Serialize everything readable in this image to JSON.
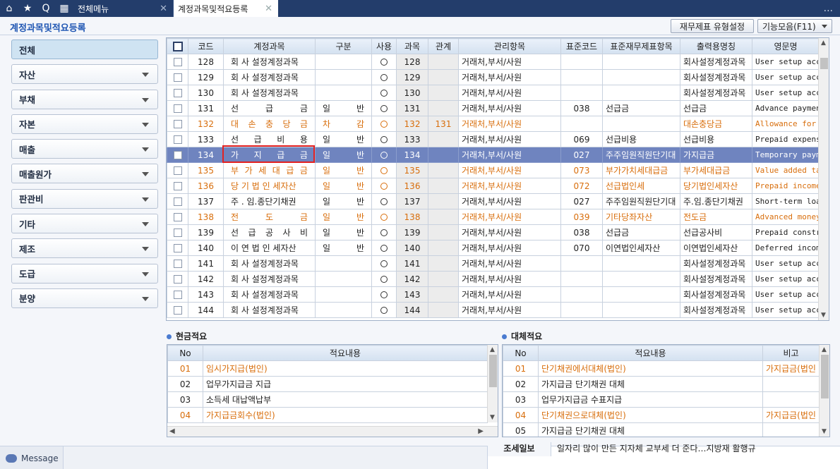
{
  "topbar": {
    "menu_tab": "전체메뉴",
    "active_tab": "계정과목및적요등록",
    "close_glyph": "✕",
    "more_glyph": "..."
  },
  "header": {
    "title": "계정과목및적요등록",
    "btn_report": "재무제표 유형설정",
    "btn_functions": "기능모음(F11)"
  },
  "sidebar": {
    "items": [
      {
        "label": "전체"
      },
      {
        "label": "자산"
      },
      {
        "label": "부채"
      },
      {
        "label": "자본"
      },
      {
        "label": "매출"
      },
      {
        "label": "매출원가"
      },
      {
        "label": "판관비"
      },
      {
        "label": "기타"
      },
      {
        "label": "제조"
      },
      {
        "label": "도급"
      },
      {
        "label": "분양"
      }
    ]
  },
  "grid": {
    "columns": [
      "코드",
      "계정과목",
      "구분",
      "사용",
      "과목",
      "관계",
      "관리항목",
      "표준코드",
      "표준재무제표항목",
      "출력용명칭",
      "영문명"
    ],
    "rows": [
      {
        "code": "128",
        "account": "회 사 설정계정과목",
        "type": "",
        "sub": "128",
        "rel": "",
        "mgmt": "거래처,부서/사원",
        "stdcode": "",
        "stditem": "",
        "print": "회사설정계정과목",
        "eng": "User setup acco"
      },
      {
        "code": "129",
        "account": "회 사 설정계정과목",
        "type": "",
        "sub": "129",
        "rel": "",
        "mgmt": "거래처,부서/사원",
        "stdcode": "",
        "stditem": "",
        "print": "회사설정계정과목",
        "eng": "User setup acco"
      },
      {
        "code": "130",
        "account": "회 사 설정계정과목",
        "type": "",
        "sub": "130",
        "rel": "",
        "mgmt": "거래처,부서/사원",
        "stdcode": "",
        "stditem": "",
        "print": "회사설정계정과목",
        "eng": "User setup acco"
      },
      {
        "code": "131",
        "account": "선 급 금",
        "type": "일 반",
        "sub": "131",
        "rel": "",
        "mgmt": "거래처,부서/사원",
        "stdcode": "038",
        "stditem": "선급금",
        "print": "선급금",
        "eng": "Advance payment"
      },
      {
        "code": "132",
        "account": "대 손 충 당 금",
        "type": "차 감",
        "sub": "132",
        "rel": "131",
        "mgmt": "거래처,부서/사원",
        "stdcode": "",
        "stditem": "",
        "print": "대손충당금",
        "eng": "Allowance for d",
        "orange": true
      },
      {
        "code": "133",
        "account": "선 급 비 용",
        "type": "일 반",
        "sub": "133",
        "rel": "",
        "mgmt": "거래처,부서/사원",
        "stdcode": "069",
        "stditem": "선급비용",
        "print": "선급비용",
        "eng": "Prepaid expense"
      },
      {
        "code": "134",
        "account": "가 지 급 금",
        "type": "일 반",
        "sub": "134",
        "rel": "",
        "mgmt": "거래처,부서/사원",
        "stdcode": "027",
        "stditem": "주주임원직원단기대",
        "print": "가지급금",
        "eng": "Temporary payme",
        "selected": true
      },
      {
        "code": "135",
        "account": "부 가 세 대 급 금",
        "type": "일 반",
        "sub": "135",
        "rel": "",
        "mgmt": "거래처,부서/사원",
        "stdcode": "073",
        "stditem": "부가가치세대급금",
        "print": "부가세대급금",
        "eng": "Value added tax",
        "orange": true
      },
      {
        "code": "136",
        "account": "당 기 법 인 세자산",
        "type": "일 반",
        "sub": "136",
        "rel": "",
        "mgmt": "거래처,부서/사원",
        "stdcode": "072",
        "stditem": "선급법인세",
        "print": "당기법인세자산",
        "eng": "Prepaid income",
        "orange": true
      },
      {
        "code": "137",
        "account": "주 . 임.종단기채권",
        "type": "일 반",
        "sub": "137",
        "rel": "",
        "mgmt": "거래처,부서/사원",
        "stdcode": "027",
        "stditem": "주주임원직원단기대",
        "print": "주.임.종단기채권",
        "eng": "Short-term loan"
      },
      {
        "code": "138",
        "account": "전 도 금",
        "type": "일 반",
        "sub": "138",
        "rel": "",
        "mgmt": "거래처,부서/사원",
        "stdcode": "039",
        "stditem": "기타당좌자산",
        "print": "전도금",
        "eng": "Advanced money",
        "orange": true
      },
      {
        "code": "139",
        "account": "선 급 공 사 비",
        "type": "일 반",
        "sub": "139",
        "rel": "",
        "mgmt": "거래처,부서/사원",
        "stdcode": "038",
        "stditem": "선급금",
        "print": "선급공사비",
        "eng": "Prepaid constru"
      },
      {
        "code": "140",
        "account": "이 연 법 인 세자산",
        "type": "일 반",
        "sub": "140",
        "rel": "",
        "mgmt": "거래처,부서/사원",
        "stdcode": "070",
        "stditem": "이연법인세자산",
        "print": "이연법인세자산",
        "eng": "Deferred income"
      },
      {
        "code": "141",
        "account": "회 사 설정계정과목",
        "type": "",
        "sub": "141",
        "rel": "",
        "mgmt": "거래처,부서/사원",
        "stdcode": "",
        "stditem": "",
        "print": "회사설정계정과목",
        "eng": "User setup acco"
      },
      {
        "code": "142",
        "account": "회 사 설정계정과목",
        "type": "",
        "sub": "142",
        "rel": "",
        "mgmt": "거래처,부서/사원",
        "stdcode": "",
        "stditem": "",
        "print": "회사설정계정과목",
        "eng": "User setup acco"
      },
      {
        "code": "143",
        "account": "회 사 설정계정과목",
        "type": "",
        "sub": "143",
        "rel": "",
        "mgmt": "거래처,부서/사원",
        "stdcode": "",
        "stditem": "",
        "print": "회사설정계정과목",
        "eng": "User setup acco"
      },
      {
        "code": "144",
        "account": "회 사 설정계정과목",
        "type": "",
        "sub": "144",
        "rel": "",
        "mgmt": "거래처,부서/사원",
        "stdcode": "",
        "stditem": "",
        "print": "회사설정계정과목",
        "eng": "User setup acco"
      }
    ]
  },
  "cash_memo": {
    "title": "현금적요",
    "columns": [
      "No",
      "적요내용"
    ],
    "rows": [
      {
        "no": "01",
        "text": "임시가지급(법인)",
        "orange": true
      },
      {
        "no": "02",
        "text": "업무가지급금 지급"
      },
      {
        "no": "03",
        "text": "소득세 대납액납부"
      },
      {
        "no": "04",
        "text": "가지급금회수(법인)",
        "orange": true
      }
    ]
  },
  "transfer_memo": {
    "title": "대체적요",
    "columns": [
      "No",
      "적요내용",
      "비고"
    ],
    "rows": [
      {
        "no": "01",
        "text": "단기채권에서대체(법인)",
        "note": "가지급금(법인",
        "orange": true
      },
      {
        "no": "02",
        "text": "가지급금 단기채권 대체",
        "note": ""
      },
      {
        "no": "03",
        "text": "업무가지급금 수표지급",
        "note": ""
      },
      {
        "no": "04",
        "text": "단기채권으로대체(법인)",
        "note": "가지급금(법인",
        "orange": true
      },
      {
        "no": "05",
        "text": "가지급금 단기채권 대체",
        "note": ""
      }
    ]
  },
  "bottom": {
    "message": "Message",
    "news_label": "조세일보",
    "news_text": "일자리 많이 만든 지자체 교부세 더 준다…지방재 활행규"
  }
}
